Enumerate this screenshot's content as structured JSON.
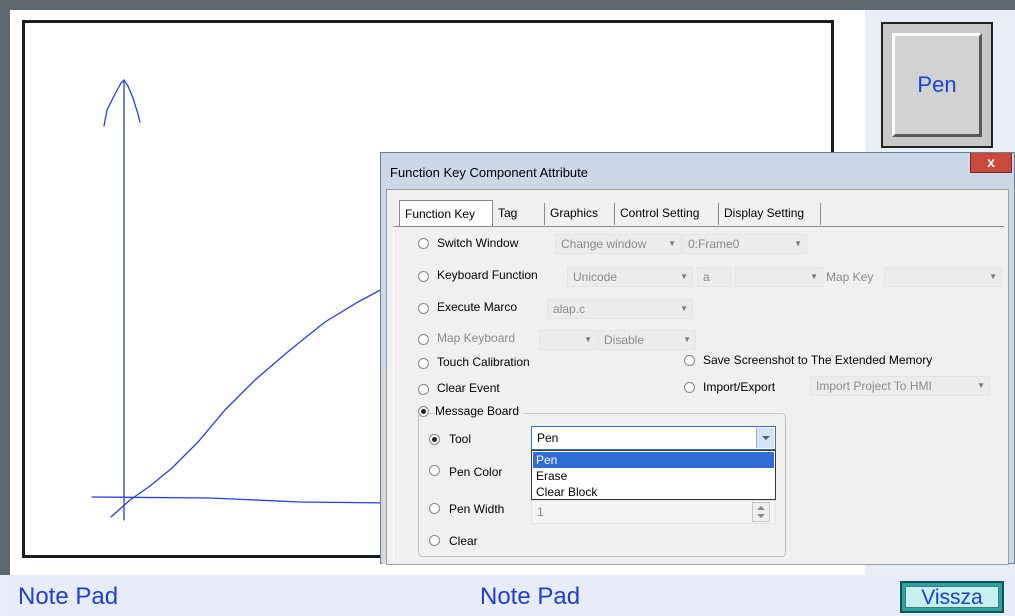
{
  "pen_button": {
    "label": "Pen"
  },
  "footer": {
    "left_label": "Note Pad",
    "center_label": "Note Pad",
    "back_button_label": "Vissza"
  },
  "dialog": {
    "title": "Function Key Component Attribute",
    "close_glyph": "x",
    "tabs": [
      "Function Key",
      "Tag",
      "Graphics",
      "Control Setting",
      "Display Setting"
    ],
    "active_tab": "Function Key",
    "options": {
      "switch_window": {
        "label": "Switch Window",
        "combo1": "Change window",
        "combo2": "0:Frame0"
      },
      "keyboard_function": {
        "label": "Keyboard Function",
        "combo1": "Unicode",
        "combo2": "a",
        "combo3": "",
        "map_key_label": "Map Key",
        "map_key_value": ""
      },
      "execute_marco": {
        "label": "Execute Marco",
        "combo1": "alap.c"
      },
      "map_keyboard": {
        "label": "Map Keyboard",
        "combo1": "",
        "combo2": "Disable"
      },
      "touch_calibration": {
        "label": "Touch Calibration"
      },
      "save_screenshot": {
        "label": "Save Screenshot to The Extended Memory"
      },
      "clear_event": {
        "label": "Clear Event"
      },
      "import_export": {
        "label": "Import/Export",
        "combo1": "Import Project To HMI"
      },
      "message_board": {
        "label": "Message Board",
        "checked": true,
        "tool": {
          "label": "Tool",
          "checked": true,
          "value": "Pen",
          "options": [
            "Pen",
            "Erase",
            "Clear Block"
          ],
          "highlighted": "Pen"
        },
        "pen_color": {
          "label": "Pen Color"
        },
        "pen_width": {
          "label": "Pen Width",
          "value": "1"
        },
        "clear": {
          "label": "Clear"
        }
      }
    }
  }
}
